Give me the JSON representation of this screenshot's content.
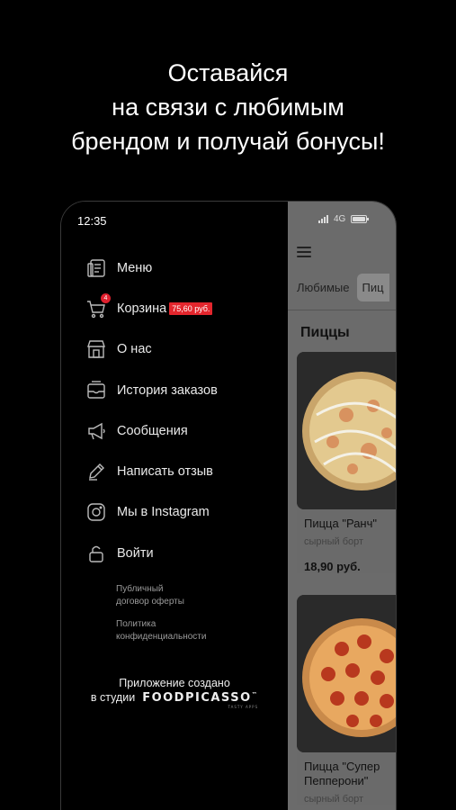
{
  "headline": [
    "Оставайся",
    "на связи с любимым",
    "брендом и получай бонусы!"
  ],
  "status": {
    "time": "12:35",
    "network": "4G"
  },
  "menu": [
    {
      "label": "Меню",
      "icon": "menu-book-icon"
    },
    {
      "label": "Корзина",
      "icon": "cart-icon",
      "badge": "4",
      "sum": "75,60 руб."
    },
    {
      "label": "О нас",
      "icon": "store-icon"
    },
    {
      "label": "История заказов",
      "icon": "order-history-icon"
    },
    {
      "label": "Сообщения",
      "icon": "megaphone-icon"
    },
    {
      "label": "Написать отзыв",
      "icon": "pencil-icon"
    },
    {
      "label": "Мы в Instagram",
      "icon": "instagram-icon"
    },
    {
      "label": "Войти",
      "icon": "lock-icon"
    }
  ],
  "legal": {
    "offer": [
      "Публичный",
      "договор оферты"
    ],
    "privacy": [
      "Политика",
      "конфиденциальности"
    ]
  },
  "credit": {
    "line1": "Приложение создано",
    "line2": "в студии",
    "brand": "FOODPICASSO",
    "brand_mark": "™",
    "tagline": "TASTY APPS"
  },
  "app": {
    "tabs": [
      "Любимые",
      "Пиц"
    ],
    "section": "Пиццы",
    "products": [
      {
        "name": "Пицца \"Ранч\"",
        "sub": "сырный борт",
        "price": "18,90 руб."
      },
      {
        "name": "Пицца \"Супер Пепперони\"",
        "sub": "сырный борт",
        "price": ""
      }
    ]
  },
  "colors": {
    "accent": "#e3262d",
    "overlay": "#6b6b6b"
  }
}
